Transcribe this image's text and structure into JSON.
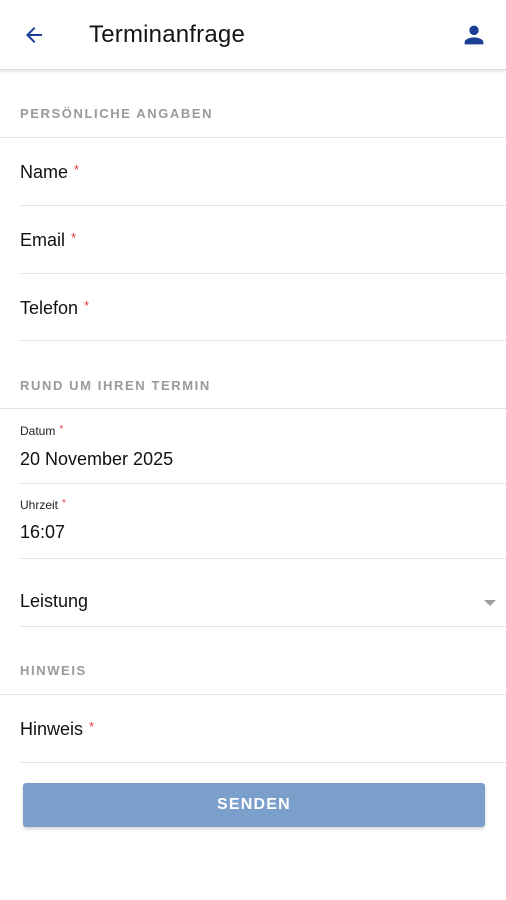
{
  "header": {
    "title": "Terminanfrage",
    "back_icon": "arrow-left-icon",
    "profile_icon": "person-icon",
    "accent_color": "#1a3f94"
  },
  "sections": {
    "personal": "PERSÖNLICHE ANGABEN",
    "appointment": "RUND UM IHREN TERMIN",
    "note": "HINWEIS"
  },
  "fields": {
    "name": {
      "label": "Name",
      "required_mark": "*"
    },
    "email": {
      "label": "Email",
      "required_mark": "*"
    },
    "phone": {
      "label": "Telefon",
      "required_mark": "*"
    },
    "date": {
      "label": "Datum",
      "required_mark": "*",
      "value": "20 November 2025"
    },
    "time": {
      "label": "Uhrzeit",
      "required_mark": "*",
      "value": "16:07"
    },
    "service": {
      "label": "Leistung",
      "icon": "dropdown-arrow-icon"
    },
    "note": {
      "label": "Hinweis",
      "required_mark": "*"
    }
  },
  "actions": {
    "send_label": "SENDEN",
    "send_color": "#7b9fcb"
  }
}
